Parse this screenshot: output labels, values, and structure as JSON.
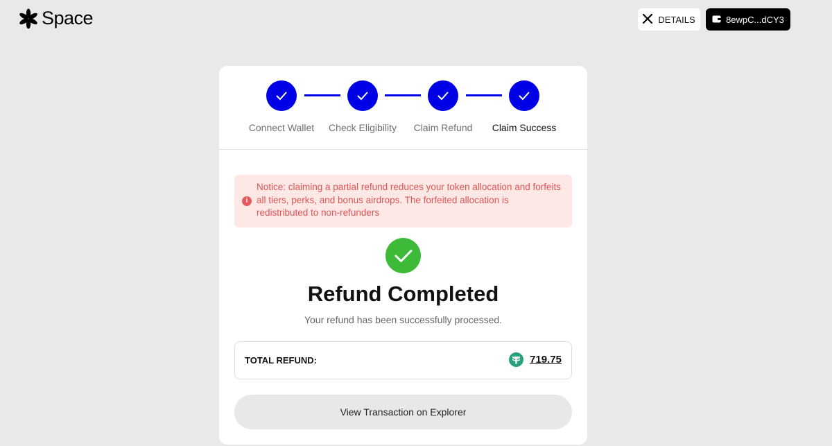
{
  "header": {
    "logo_text": "Space",
    "details_label": "DETAILS",
    "wallet_label": "8ewpC...dCY3"
  },
  "steps": [
    {
      "label": "Connect Wallet",
      "completed": true
    },
    {
      "label": "Check Eligibility",
      "completed": true
    },
    {
      "label": "Claim Refund",
      "completed": true
    },
    {
      "label": "Claim Success",
      "completed": true,
      "active": true
    }
  ],
  "notice": {
    "icon": "info-icon",
    "text": "Notice: claiming a partial refund reduces your token allocation and forfeits all tiers, perks, and bonus airdrops. The forfeited allocation is redistributed to non-refunders"
  },
  "result": {
    "title": "Refund Completed",
    "subtitle": "Your refund has been successfully processed."
  },
  "total": {
    "label": "TOTAL REFUND:",
    "value": "719.75",
    "token_icon": "usdt-icon"
  },
  "explorer_button": {
    "label": "View Transaction on Explorer"
  },
  "colors": {
    "background": "#e9e9e9",
    "step_blue": "#0000e6",
    "success_green": "#3dba37",
    "notice_bg": "#fde8e6",
    "notice_text": "#e05454",
    "usdt_green": "#26a17b"
  }
}
